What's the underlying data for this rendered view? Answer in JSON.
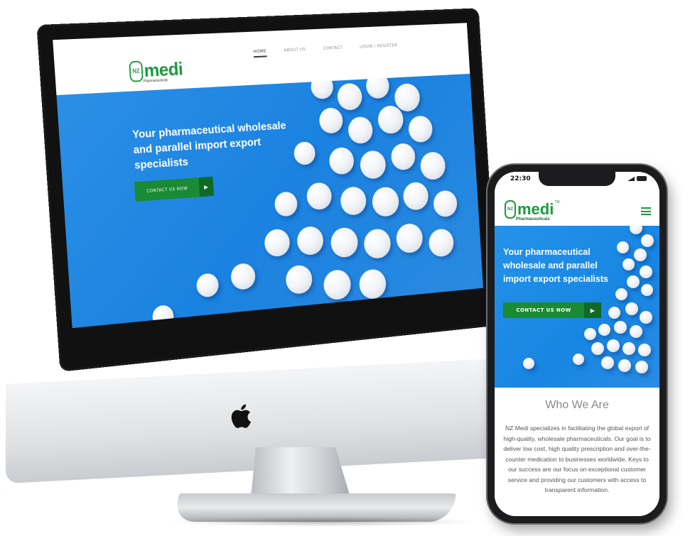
{
  "desktop": {
    "logo": {
      "word": "medi",
      "mark": "NZ",
      "sub": "Pharmaceuticals"
    },
    "nav": [
      "HOME",
      "ABOUT US",
      "CONTACT",
      "LOGIN / REGISTER"
    ],
    "hero": {
      "title": "Your pharmaceutical wholesale and parallel import export specialists",
      "cta": "CONTACT US NOW",
      "cta_arrow": "▶"
    },
    "apple_icon": "apple-logo-icon"
  },
  "phone": {
    "status_time": "22:30",
    "logo": {
      "word": "medi",
      "mark": "NZ",
      "sub": "Pharmaceuticals",
      "tm": "TM"
    },
    "hero": {
      "title": "Your pharmaceutical wholesale and parallel import export specialists",
      "cta": "CONTACT US NOW",
      "cta_arrow": "▶"
    },
    "who_title": "Who We Are",
    "who_text": "NZ Medi specializes in facilitating the global export of high-quality, wholesale pharmaceuticals. Our goal is to deliver low cost, high quality prescription and over-the-counter medication to businesses worldwide. Keys to our success are our focus on exceptional customer service and providing our customers with access to transparent information."
  },
  "colors": {
    "brand_green": "#1a9a3c",
    "cta_green": "#1a8a34",
    "hero_blue": "#1a82e0"
  }
}
